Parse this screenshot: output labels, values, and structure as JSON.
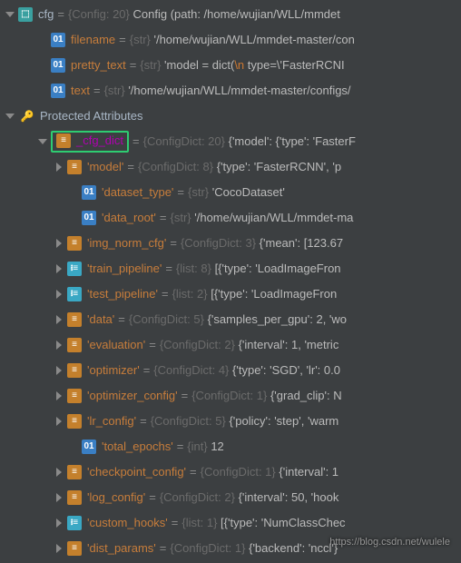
{
  "root": {
    "name": "cfg",
    "eq": "=",
    "hint": "{Config: 20}",
    "value": "Config (path: /home/wujian/WLL/mmdet"
  },
  "rows": [
    {
      "indent": 36,
      "arrow": "none",
      "icon": "str",
      "icon_label": "01",
      "name": "filename",
      "eq": "=",
      "hint": "{str}",
      "value": "'/home/wujian/WLL/mmdet-master/con"
    },
    {
      "indent": 36,
      "arrow": "none",
      "icon": "str",
      "icon_label": "01",
      "name": "pretty_text",
      "eq": "=",
      "hint": "{str}",
      "value_parts": [
        "'model = dict(",
        "\\n",
        "    type=\\'FasterRCNI"
      ]
    },
    {
      "indent": 36,
      "arrow": "none",
      "icon": "str",
      "icon_label": "01",
      "name": "text",
      "eq": "=",
      "hint": "{str}",
      "value": "'/home/wujian/WLL/mmdet-master/configs/"
    },
    {
      "indent": 18,
      "arrow": "none",
      "icon": "key",
      "icon_label": "🔑",
      "section": true,
      "name": "Protected Attributes"
    },
    {
      "indent": 36,
      "arrow": "down",
      "icon": "dict",
      "icon_label": "≡",
      "highlight": true,
      "special": true,
      "name": "_cfg_dict",
      "eq": "=",
      "hint": "{ConfigDict: 20}",
      "value": "{'model': {'type': 'FasterF"
    },
    {
      "indent": 54,
      "arrow": "right",
      "icon": "dict",
      "icon_label": "≡",
      "name": "'model'",
      "eq": "=",
      "hint": "{ConfigDict: 8}",
      "value": "{'type': 'FasterRCNN', 'p"
    },
    {
      "indent": 70,
      "arrow": "none",
      "icon": "str",
      "icon_label": "01",
      "name": "'dataset_type'",
      "eq": "=",
      "hint": "{str}",
      "value": "'CocoDataset'"
    },
    {
      "indent": 70,
      "arrow": "none",
      "icon": "str",
      "icon_label": "01",
      "name": "'data_root'",
      "eq": "=",
      "hint": "{str}",
      "value": "'/home/wujian/WLL/mmdet-ma"
    },
    {
      "indent": 54,
      "arrow": "right",
      "icon": "dict",
      "icon_label": "≡",
      "name": "'img_norm_cfg'",
      "eq": "=",
      "hint": "{ConfigDict: 3}",
      "value": "{'mean': [123.67"
    },
    {
      "indent": 54,
      "arrow": "right",
      "icon": "list",
      "icon_label": "᎒≡",
      "name": "'train_pipeline'",
      "eq": "=",
      "hint": "{list: 8}",
      "value": "[{'type': 'LoadImageFron"
    },
    {
      "indent": 54,
      "arrow": "right",
      "icon": "list",
      "icon_label": "᎒≡",
      "name": "'test_pipeline'",
      "eq": "=",
      "hint": "{list: 2}",
      "value": "[{'type': 'LoadImageFron"
    },
    {
      "indent": 54,
      "arrow": "right",
      "icon": "dict",
      "icon_label": "≡",
      "name": "'data'",
      "eq": "=",
      "hint": "{ConfigDict: 5}",
      "value": "{'samples_per_gpu': 2, 'wo"
    },
    {
      "indent": 54,
      "arrow": "right",
      "icon": "dict",
      "icon_label": "≡",
      "name": "'evaluation'",
      "eq": "=",
      "hint": "{ConfigDict: 2}",
      "value": "{'interval': 1, 'metric"
    },
    {
      "indent": 54,
      "arrow": "right",
      "icon": "dict",
      "icon_label": "≡",
      "name": "'optimizer'",
      "eq": "=",
      "hint": "{ConfigDict: 4}",
      "value": "{'type': 'SGD', 'lr': 0.0"
    },
    {
      "indent": 54,
      "arrow": "right",
      "icon": "dict",
      "icon_label": "≡",
      "name": "'optimizer_config'",
      "eq": "=",
      "hint": "{ConfigDict: 1}",
      "value": "{'grad_clip': N"
    },
    {
      "indent": 54,
      "arrow": "right",
      "icon": "dict",
      "icon_label": "≡",
      "name": "'lr_config'",
      "eq": "=",
      "hint": "{ConfigDict: 5}",
      "value": "{'policy': 'step', 'warm"
    },
    {
      "indent": 70,
      "arrow": "none",
      "icon": "str",
      "icon_label": "01",
      "name": "'total_epochs'",
      "eq": "=",
      "hint": "{int}",
      "value": "12"
    },
    {
      "indent": 54,
      "arrow": "right",
      "icon": "dict",
      "icon_label": "≡",
      "name": "'checkpoint_config'",
      "eq": "=",
      "hint": "{ConfigDict: 1}",
      "value": "{'interval': 1"
    },
    {
      "indent": 54,
      "arrow": "right",
      "icon": "dict",
      "icon_label": "≡",
      "name": "'log_config'",
      "eq": "=",
      "hint": "{ConfigDict: 2}",
      "value": "{'interval': 50, 'hook"
    },
    {
      "indent": 54,
      "arrow": "right",
      "icon": "list",
      "icon_label": "᎒≡",
      "name": "'custom_hooks'",
      "eq": "=",
      "hint": "{list: 1}",
      "value": "[{'type': 'NumClassChec"
    },
    {
      "indent": 54,
      "arrow": "right",
      "icon": "dict",
      "icon_label": "≡",
      "name": "'dist_params'",
      "eq": "=",
      "hint": "{ConfigDict: 1}",
      "value": "{'backend': 'nccl'}"
    }
  ],
  "section_arrow": "down",
  "watermark": "https://blog.csdn.net/wulele"
}
